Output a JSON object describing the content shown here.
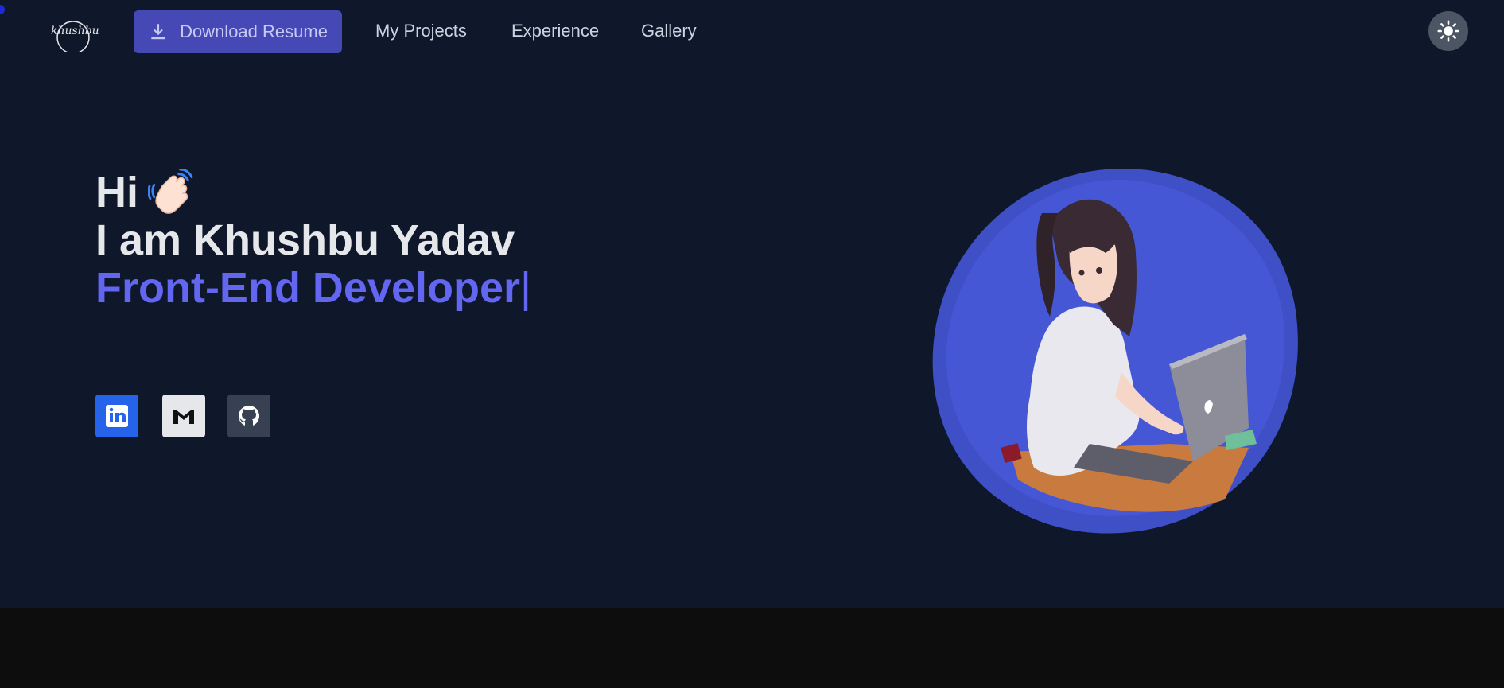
{
  "header": {
    "logo_text": "khushbu",
    "resume_button": "Download Resume",
    "nav": [
      "My Projects",
      "Experience",
      "Gallery"
    ],
    "theme_icon": "sun-icon"
  },
  "hero": {
    "greeting": "Hi",
    "wave_icon": "waving-hand-icon",
    "intro": "I am Khushbu Yadav",
    "role": "Front-End Developer",
    "cursor": "|"
  },
  "socials": [
    {
      "name": "linkedin-icon"
    },
    {
      "name": "gmail-icon"
    },
    {
      "name": "github-icon"
    }
  ],
  "colors": {
    "background": "#0f172a",
    "accent": "#6366f1",
    "button": "#4548b5",
    "blob": "#4353d1",
    "bottom_band": "#0d0d0d"
  }
}
